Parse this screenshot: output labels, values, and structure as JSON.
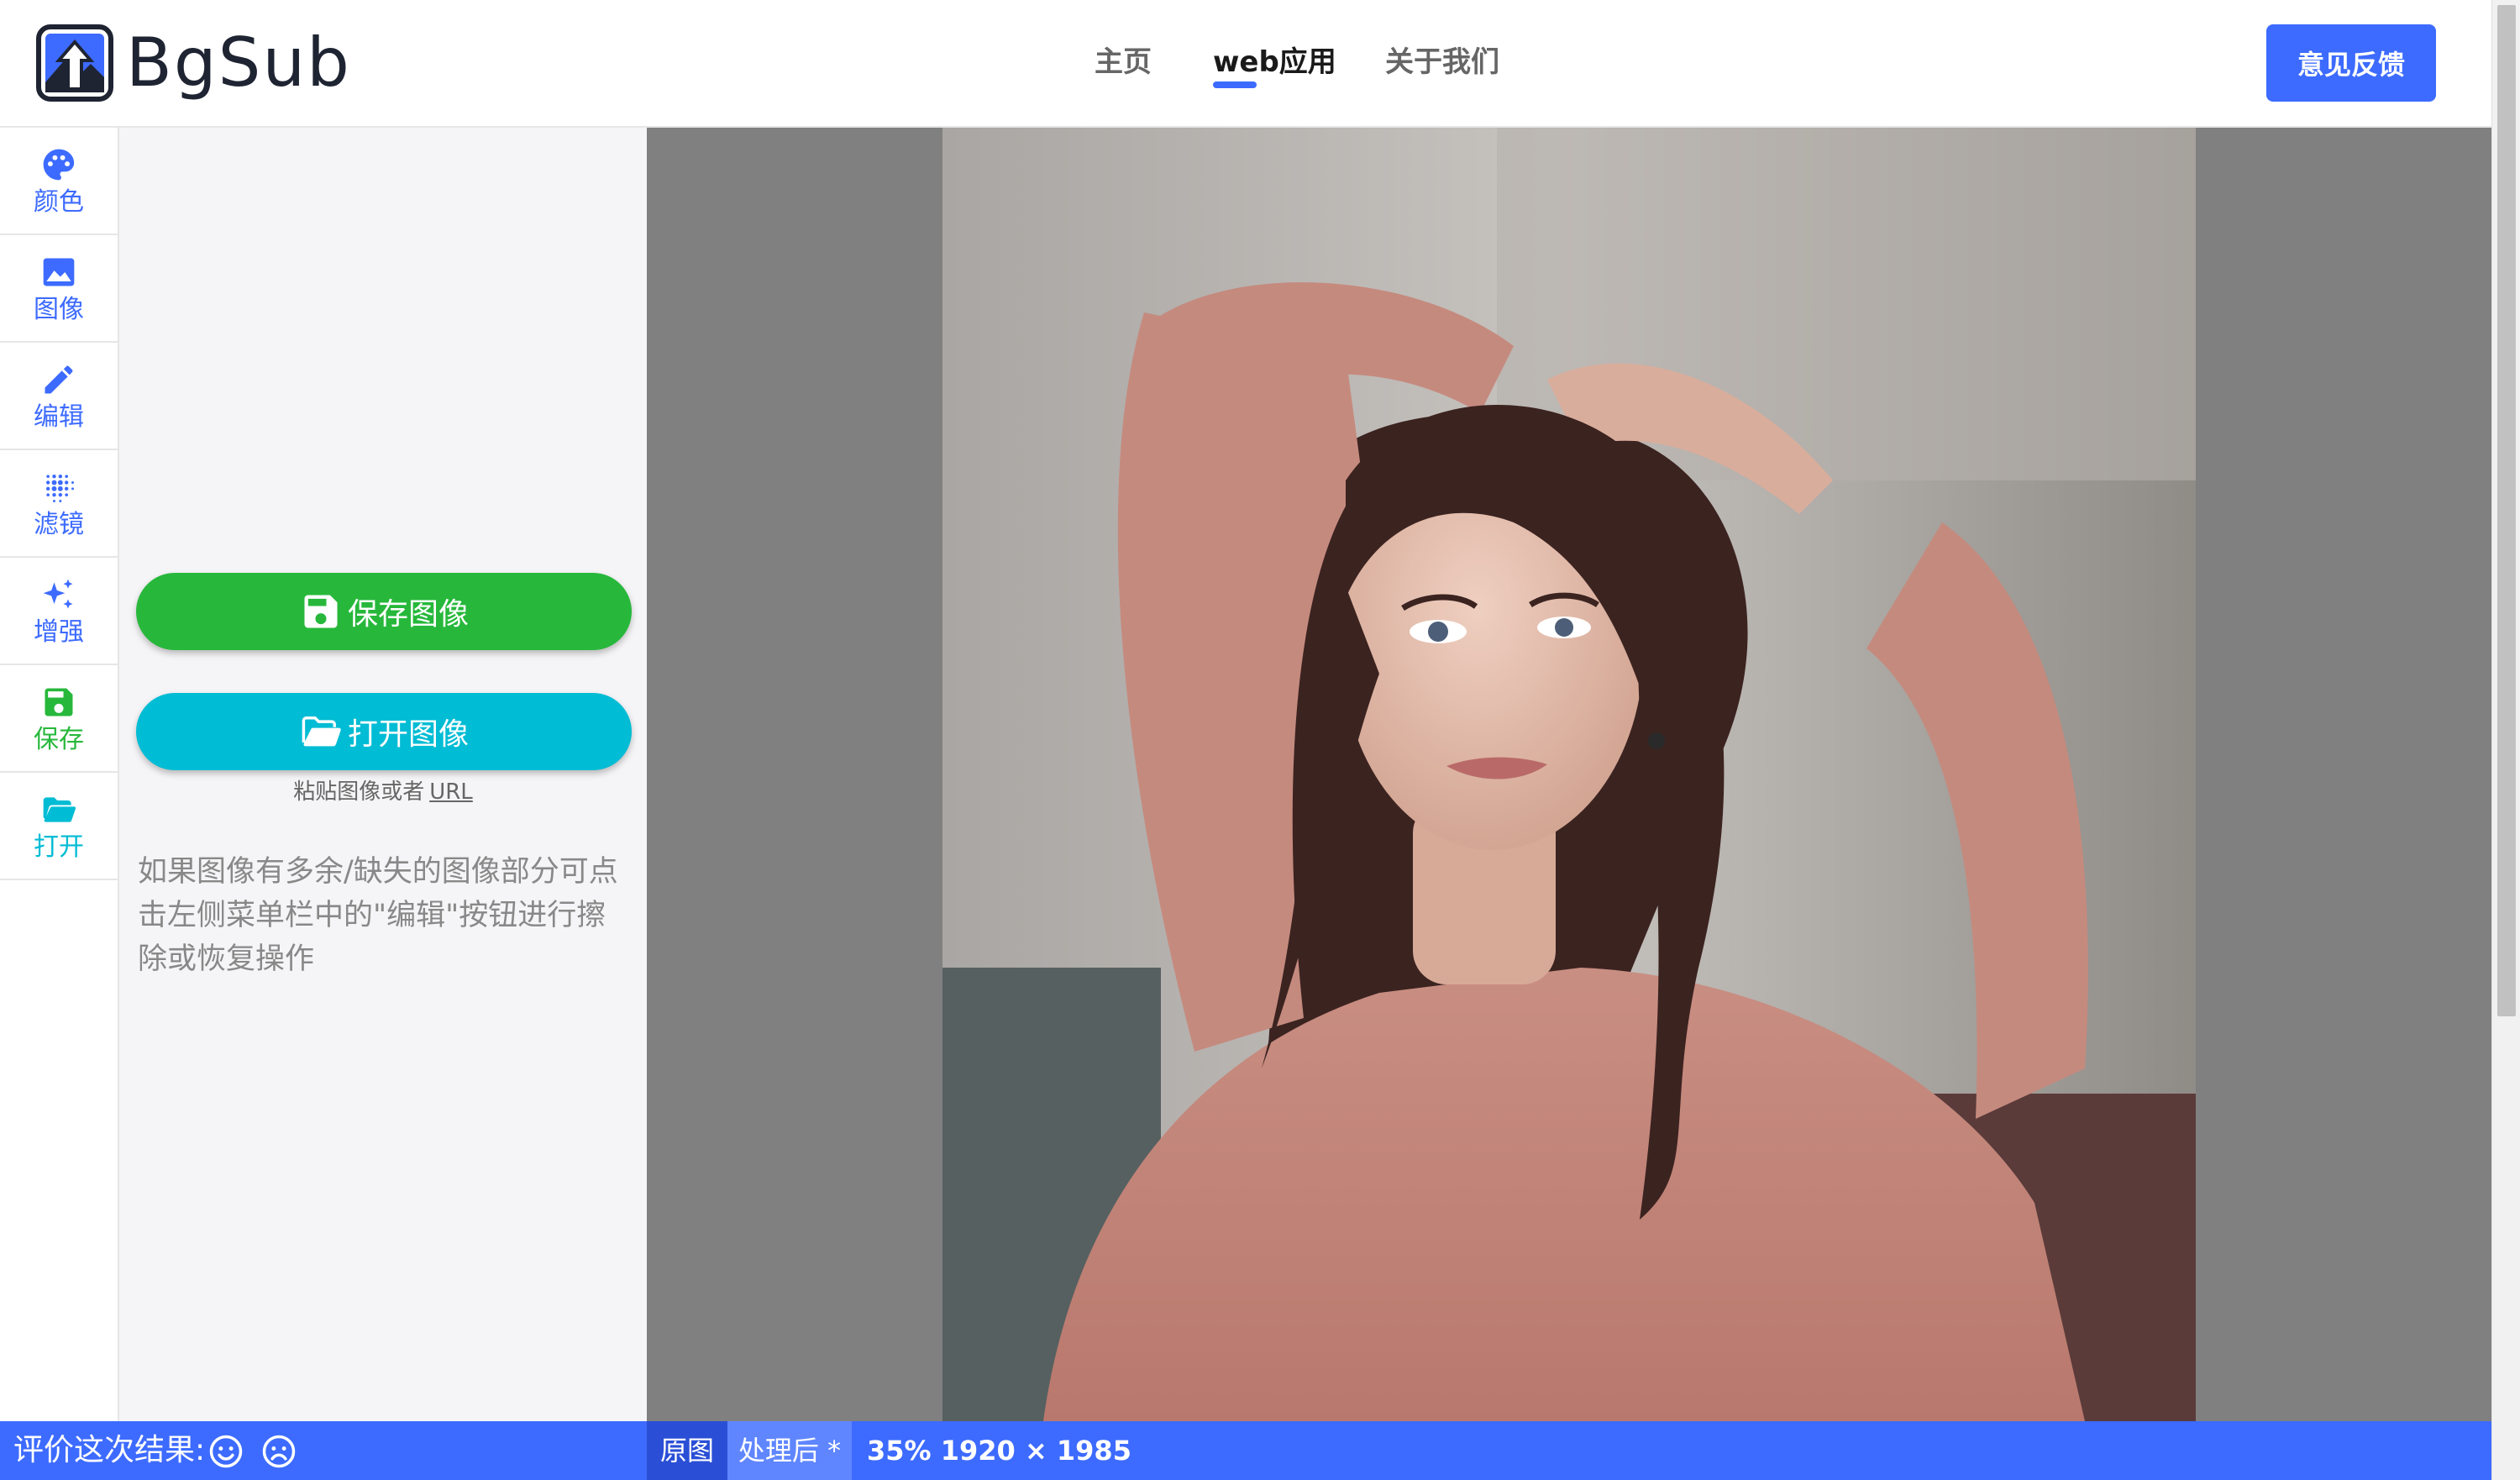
{
  "header": {
    "logo_text": "BgSub",
    "nav": [
      {
        "label": "主页",
        "active": false
      },
      {
        "label": "web应用",
        "active": true
      },
      {
        "label": "关于我们",
        "active": false
      }
    ],
    "feedback_label": "意见反馈"
  },
  "sidebar": {
    "items": [
      {
        "label": "颜色",
        "icon": "palette-icon"
      },
      {
        "label": "图像",
        "icon": "image-icon"
      },
      {
        "label": "编辑",
        "icon": "pencil-icon"
      },
      {
        "label": "滤镜",
        "icon": "dots-filter-icon"
      },
      {
        "label": "增强",
        "icon": "sparkle-icon"
      },
      {
        "label": "保存",
        "icon": "floppy-disk-icon"
      },
      {
        "label": "打开",
        "icon": "folder-open-icon"
      }
    ]
  },
  "panel": {
    "save_label": "保存图像",
    "open_label": "打开图像",
    "paste_hint": "粘贴图像或者",
    "paste_link": "URL",
    "tip": "如果图像有多余/缺失的图像部分可点击左侧菜单栏中的\"编辑\"按钮进行擦除或恢复操作"
  },
  "bottombar": {
    "rate_label": "评价这次结果:",
    "tab_original": "原图",
    "tab_processed": "处理后 *",
    "zoom_info": "35% 1920 × 1985"
  },
  "colors": {
    "accent": "#3d6bff",
    "save_green": "#27b83b",
    "open_cyan": "#00bcd4",
    "canvas_gray": "#808080"
  }
}
